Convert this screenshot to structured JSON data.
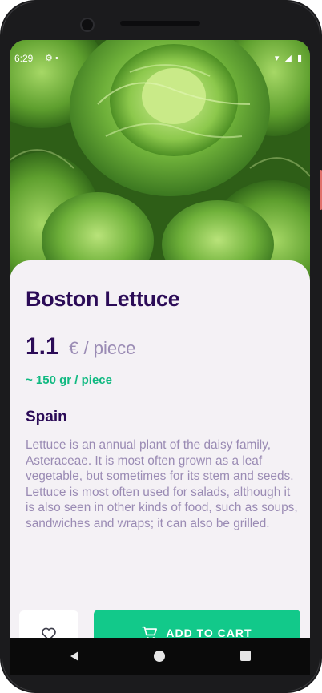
{
  "status_bar": {
    "time": "6:29",
    "left_icons": [
      "gear-icon",
      "dot-icon"
    ],
    "right_icons": [
      "wifi-icon",
      "signal-icon",
      "battery-icon"
    ]
  },
  "hero": {
    "image": "boston-lettuce-photo",
    "carousel": {
      "total": 3,
      "active_index": 0
    }
  },
  "product": {
    "name": "Boston Lettuce",
    "price": "1.1",
    "price_unit": "€ / piece",
    "weight": "~ 150 gr / piece",
    "origin": "Spain",
    "description": "Lettuce is an annual plant of the daisy family, Asteraceae. It is most often grown as a leaf vegetable, but sometimes for its stem and seeds. Lettuce is most often used for salads, although it is also seen in other kinds of food, such as soups, sandwiches and wraps; it can also be grilled."
  },
  "actions": {
    "favorite_icon": "heart-icon",
    "add_to_cart_label": "ADD TO CART",
    "cart_icon": "cart-icon"
  },
  "nav": {
    "back": "back-icon",
    "home": "home-icon",
    "recents": "recents-icon"
  },
  "colors": {
    "title": "#2b0b57",
    "muted": "#9a8bb4",
    "accent": "#12c98a",
    "background": "#f4f1f5"
  }
}
